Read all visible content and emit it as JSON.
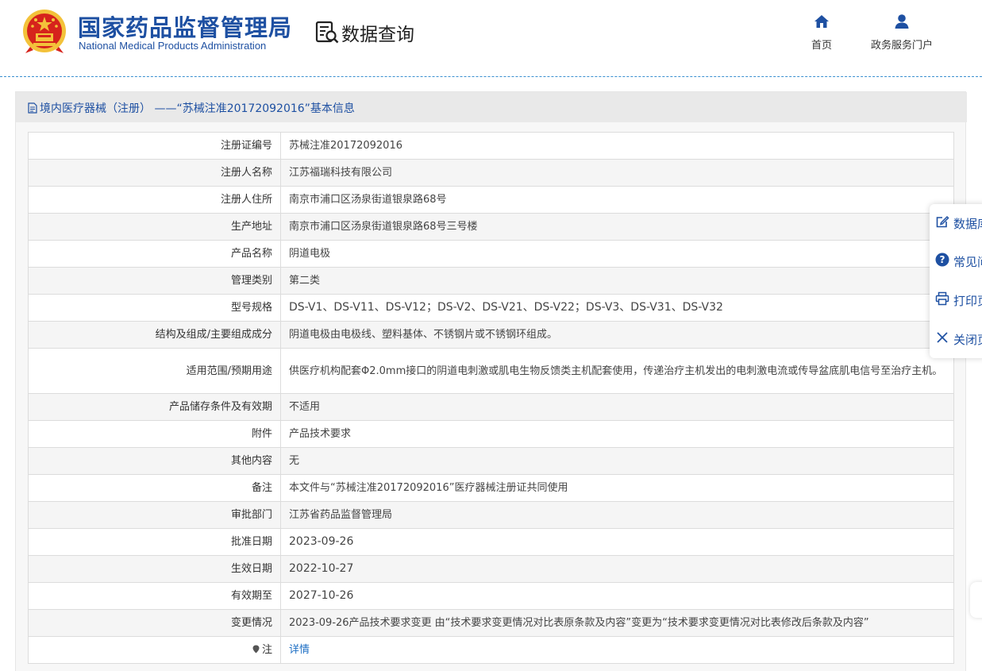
{
  "header": {
    "brand_cn": "国家药品监督管理局",
    "brand_en": "National Medical Products Administration",
    "query_title": "数据查询",
    "nav": [
      {
        "label": "首页",
        "icon": "home-icon"
      },
      {
        "label": "政务服务门户",
        "icon": "user-icon"
      }
    ]
  },
  "panel": {
    "title": "境内医疗器械（注册） ——“苏械注准20172092016”基本信息"
  },
  "rows": [
    {
      "key": "注册证编号",
      "value": "苏械注准20172092016"
    },
    {
      "key": "注册人名称",
      "value": "江苏福瑞科技有限公司"
    },
    {
      "key": "注册人住所",
      "value": "南京市浦口区汤泉街道银泉路68号"
    },
    {
      "key": "生产地址",
      "value": "南京市浦口区汤泉街道银泉路68号三号楼"
    },
    {
      "key": "产品名称",
      "value": "阴道电极"
    },
    {
      "key": "管理类别",
      "value": "第二类"
    },
    {
      "key": "型号规格",
      "value": "DS-V1、DS-V11、DS-V12；DS-V2、DS-V21、DS-V22；DS-V3、DS-V31、DS-V32"
    },
    {
      "key": "结构及组成/主要组成成分",
      "value": "阴道电极由电极线、塑料基体、不锈钢片或不锈钢环组成。"
    },
    {
      "key": "适用范围/预期用途",
      "value": "供医疗机构配套Φ2.0mm接口的阴道电刺激或肌电生物反馈类主机配套使用，传递治疗主机发出的电刺激电流或传导盆底肌电信号至治疗主机。"
    },
    {
      "key": "产品储存条件及有效期",
      "value": "不适用"
    },
    {
      "key": "附件",
      "value": "产品技术要求"
    },
    {
      "key": "其他内容",
      "value": "无"
    },
    {
      "key": "备注",
      "value": "本文件与“苏械注准20172092016”医疗器械注册证共同使用"
    },
    {
      "key": "审批部门",
      "value": "江苏省药品监督管理局"
    },
    {
      "key": "批准日期",
      "value": "2023-09-26"
    },
    {
      "key": "生效日期",
      "value": "2022-10-27"
    },
    {
      "key": "有效期至",
      "value": "2027-10-26"
    },
    {
      "key": "变更情况",
      "value": "2023-09-26产品技术要求变更 由“技术要求变更情况对比表原条款及内容”变更为“技术要求变更情况对比表修改后条款及内容”"
    },
    {
      "key": "注",
      "value": "详情"
    }
  ],
  "side_toolbar": [
    {
      "label": "数据库",
      "icon": "edit-icon"
    },
    {
      "label": "常见问题",
      "icon": "question-icon"
    },
    {
      "label": "打印页面",
      "icon": "printer-icon"
    },
    {
      "label": "关闭页面",
      "icon": "close-icon"
    }
  ],
  "colors": {
    "brand": "#1e50a2",
    "link": "#1e6fc4",
    "emblem_red": "#d6231c",
    "emblem_gold": "#f3c23a"
  }
}
